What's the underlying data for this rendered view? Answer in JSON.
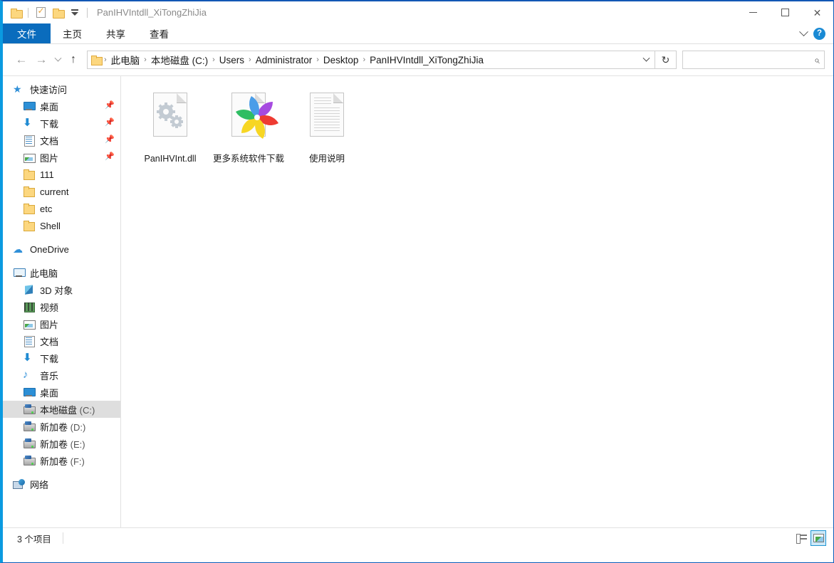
{
  "window": {
    "title": "PanIHVIntdll_XiTongZhiJia",
    "minimize_label": "—",
    "maximize_label": "",
    "close_label": "✕"
  },
  "quick_access_toolbar": {
    "items": [
      {
        "name": "folder-icon",
        "label": ""
      },
      {
        "name": "properties-icon",
        "label": ""
      },
      {
        "name": "new-folder-icon",
        "label": ""
      },
      {
        "name": "customize-dropdown",
        "label": ""
      }
    ]
  },
  "ribbon": {
    "tabs": [
      {
        "label": "文件",
        "active": true
      },
      {
        "label": "主页",
        "active": false
      },
      {
        "label": "共享",
        "active": false
      },
      {
        "label": "查看",
        "active": false
      }
    ],
    "expand_label": "",
    "help_label": "?"
  },
  "addressbar": {
    "back_label": "←",
    "forward_label": "→",
    "recent_label": "",
    "up_label": "↑",
    "crumbs": [
      {
        "label": "此电脑",
        "dim": ""
      },
      {
        "label": "本地磁盘",
        "dim": " (C:)"
      },
      {
        "label": "Users",
        "dim": ""
      },
      {
        "label": "Administrator",
        "dim": ""
      },
      {
        "label": "Desktop",
        "dim": ""
      },
      {
        "label": "PanIHVIntdll_XiTongZhiJia",
        "dim": ""
      }
    ],
    "separator": "›",
    "refresh_label": "↻",
    "search": {
      "value": "",
      "placeholder": "",
      "icon_label": "⌕"
    }
  },
  "sidebar": {
    "items": [
      {
        "label": "快速访问",
        "dim": "",
        "icon": "ic-star",
        "level": 0,
        "glyph": "★",
        "pinned": false,
        "selected": false
      },
      {
        "label": "桌面",
        "dim": "",
        "icon": "ic-desktop",
        "level": 1,
        "glyph": "",
        "pinned": true,
        "selected": false
      },
      {
        "label": "下载",
        "dim": "",
        "icon": "ic-download",
        "level": 1,
        "glyph": "⬇",
        "pinned": true,
        "selected": false
      },
      {
        "label": "文档",
        "dim": "",
        "icon": "ic-doc",
        "level": 1,
        "glyph": "",
        "pinned": true,
        "selected": false
      },
      {
        "label": "图片",
        "dim": "",
        "icon": "ic-pic",
        "level": 1,
        "glyph": "",
        "pinned": true,
        "selected": false
      },
      {
        "label": "111",
        "dim": "",
        "icon": "ic-folder",
        "level": 1,
        "glyph": "",
        "pinned": false,
        "selected": false
      },
      {
        "label": "current",
        "dim": "",
        "icon": "ic-folder",
        "level": 1,
        "glyph": "",
        "pinned": false,
        "selected": false
      },
      {
        "label": "etc",
        "dim": "",
        "icon": "ic-folder",
        "level": 1,
        "glyph": "",
        "pinned": false,
        "selected": false
      },
      {
        "label": "Shell",
        "dim": "",
        "icon": "ic-folder",
        "level": 1,
        "glyph": "",
        "pinned": false,
        "selected": false
      },
      {
        "label": "",
        "dim": "",
        "icon": "spacer",
        "level": 0,
        "glyph": "",
        "pinned": false,
        "selected": false
      },
      {
        "label": "OneDrive",
        "dim": "",
        "icon": "ic-cloud",
        "level": 0,
        "glyph": "☁",
        "pinned": false,
        "selected": false
      },
      {
        "label": "",
        "dim": "",
        "icon": "spacer",
        "level": 0,
        "glyph": "",
        "pinned": false,
        "selected": false
      },
      {
        "label": "此电脑",
        "dim": "",
        "icon": "ic-pc",
        "level": 0,
        "glyph": "",
        "pinned": false,
        "selected": false
      },
      {
        "label": "3D 对象",
        "dim": "",
        "icon": "ic-3d",
        "level": 1,
        "glyph": "",
        "pinned": false,
        "selected": false
      },
      {
        "label": "视频",
        "dim": "",
        "icon": "ic-video",
        "level": 1,
        "glyph": "",
        "pinned": false,
        "selected": false
      },
      {
        "label": "图片",
        "dim": "",
        "icon": "ic-pic",
        "level": 1,
        "glyph": "",
        "pinned": false,
        "selected": false
      },
      {
        "label": "文档",
        "dim": "",
        "icon": "ic-doc",
        "level": 1,
        "glyph": "",
        "pinned": false,
        "selected": false
      },
      {
        "label": "下载",
        "dim": "",
        "icon": "ic-download",
        "level": 1,
        "glyph": "⬇",
        "pinned": false,
        "selected": false
      },
      {
        "label": "音乐",
        "dim": "",
        "icon": "ic-music",
        "level": 1,
        "glyph": "♪",
        "pinned": false,
        "selected": false
      },
      {
        "label": "桌面",
        "dim": "",
        "icon": "ic-desktop",
        "level": 1,
        "glyph": "",
        "pinned": false,
        "selected": false
      },
      {
        "label": "本地磁盘",
        "dim": " (C:)",
        "icon": "ic-drive",
        "level": 1,
        "glyph": "",
        "pinned": false,
        "selected": true
      },
      {
        "label": "新加卷",
        "dim": " (D:)",
        "icon": "ic-drive",
        "level": 1,
        "glyph": "",
        "pinned": false,
        "selected": false
      },
      {
        "label": "新加卷",
        "dim": " (E:)",
        "icon": "ic-drive",
        "level": 1,
        "glyph": "",
        "pinned": false,
        "selected": false
      },
      {
        "label": "新加卷",
        "dim": " (F:)",
        "icon": "ic-drive",
        "level": 1,
        "glyph": "",
        "pinned": false,
        "selected": false
      },
      {
        "label": "",
        "dim": "",
        "icon": "spacer",
        "level": 0,
        "glyph": "",
        "pinned": false,
        "selected": false
      },
      {
        "label": "网络",
        "dim": "",
        "icon": "ic-net",
        "level": 0,
        "glyph": "",
        "pinned": false,
        "selected": false
      }
    ],
    "pin_glyph": "📌"
  },
  "content": {
    "files": [
      {
        "name": "PanIHVInt.dll",
        "icon": "dll-gears-icon"
      },
      {
        "name": "更多系统软件下载",
        "icon": "pinwheel-browser-icon"
      },
      {
        "name": "使用说明",
        "icon": "text-document-icon"
      }
    ]
  },
  "statusbar": {
    "item_count": "3 个项目",
    "views": [
      {
        "name": "details-view",
        "active": false
      },
      {
        "name": "large-icons-view",
        "active": true
      }
    ]
  },
  "colors": {
    "accent_blue": "#0a6cbd",
    "border_blue": "#0a9ae0",
    "title_blue": "#1257b5",
    "selection_gray": "#dedede",
    "folder_yellow": "#fcd77f"
  }
}
